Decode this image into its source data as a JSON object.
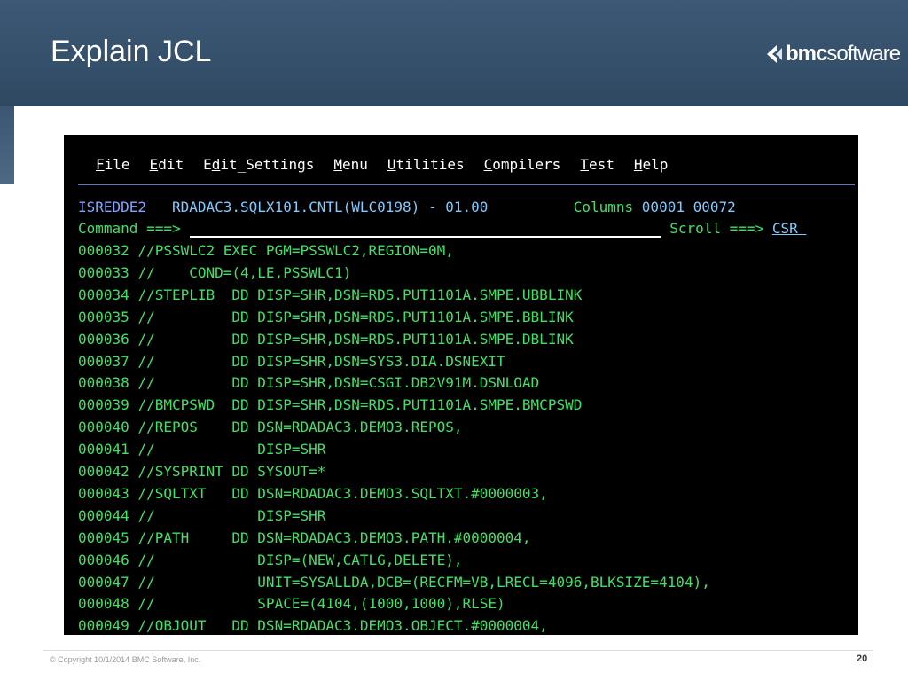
{
  "slide": {
    "title": "Explain JCL",
    "logo_bold": "bmc",
    "logo_rest": "software",
    "copyright": "© Copyright 10/1/2014 BMC Software, Inc.",
    "page_number": "20"
  },
  "colors": {
    "header": "#3c5874",
    "terminal_bg": "#000000",
    "jcl_green": "#42e063",
    "panel_blue": "#7ea6ff",
    "cyan": "#7ecbff"
  },
  "menu": [
    {
      "mnemonic": "F",
      "rest": "ile"
    },
    {
      "mnemonic": "E",
      "rest": "dit"
    },
    {
      "prefix": "E",
      "mnemonic": "d",
      "rest": "it_Settings"
    },
    {
      "mnemonic": "M",
      "rest": "enu"
    },
    {
      "mnemonic": "U",
      "rest": "tilities"
    },
    {
      "mnemonic": "C",
      "rest": "ompilers"
    },
    {
      "mnemonic": "T",
      "rest": "est"
    },
    {
      "mnemonic": "H",
      "rest": "elp"
    }
  ],
  "panel": {
    "id": "ISREDDE2",
    "dataset": "RDADAC3.SQLX101.CNTL(WLC0198) - 01.00",
    "columns_label": "Columns",
    "columns_from": "00001",
    "columns_to": "00072",
    "command_label": "Command ===>",
    "command_value": "",
    "scroll_label": "Scroll ===>",
    "scroll_value": "CSR "
  },
  "lines": [
    {
      "num": "000032",
      "text": "//PSSWLC2 EXEC PGM=PSSWLC2,REGION=0M,"
    },
    {
      "num": "000033",
      "text": "//    COND=(4,LE,PSSWLC1)"
    },
    {
      "num": "000034",
      "text": "//STEPLIB  DD DISP=SHR,DSN=RDS.PUT1101A.SMPE.UBBLINK"
    },
    {
      "num": "000035",
      "text": "//         DD DISP=SHR,DSN=RDS.PUT1101A.SMPE.BBLINK"
    },
    {
      "num": "000036",
      "text": "//         DD DISP=SHR,DSN=RDS.PUT1101A.SMPE.DBLINK"
    },
    {
      "num": "000037",
      "text": "//         DD DISP=SHR,DSN=SYS3.DIA.DSNEXIT"
    },
    {
      "num": "000038",
      "text": "//         DD DISP=SHR,DSN=CSGI.DB2V91M.DSNLOAD"
    },
    {
      "num": "000039",
      "text": "//BMCPSWD  DD DISP=SHR,DSN=RDS.PUT1101A.SMPE.BMCPSWD"
    },
    {
      "num": "000040",
      "text": "//REPOS    DD DSN=RDADAC3.DEMO3.REPOS,"
    },
    {
      "num": "000041",
      "text": "//            DISP=SHR"
    },
    {
      "num": "000042",
      "text": "//SYSPRINT DD SYSOUT=*"
    },
    {
      "num": "000043",
      "text": "//SQLTXT   DD DSN=RDADAC3.DEMO3.SQLTXT.#0000003,"
    },
    {
      "num": "000044",
      "text": "//            DISP=SHR"
    },
    {
      "num": "000045",
      "text": "//PATH     DD DSN=RDADAC3.DEMO3.PATH.#0000004,"
    },
    {
      "num": "000046",
      "text": "//            DISP=(NEW,CATLG,DELETE),"
    },
    {
      "num": "000047",
      "text": "//            UNIT=SYSALLDA,DCB=(RECFM=VB,LRECL=4096,BLKSIZE=4104),"
    },
    {
      "num": "000048",
      "text": "//            SPACE=(4104,(1000,1000),RLSE)"
    },
    {
      "num": "000049",
      "text": "//OBJOUT   DD DSN=RDADAC3.DEMO3.OBJECT.#0000004,"
    }
  ]
}
